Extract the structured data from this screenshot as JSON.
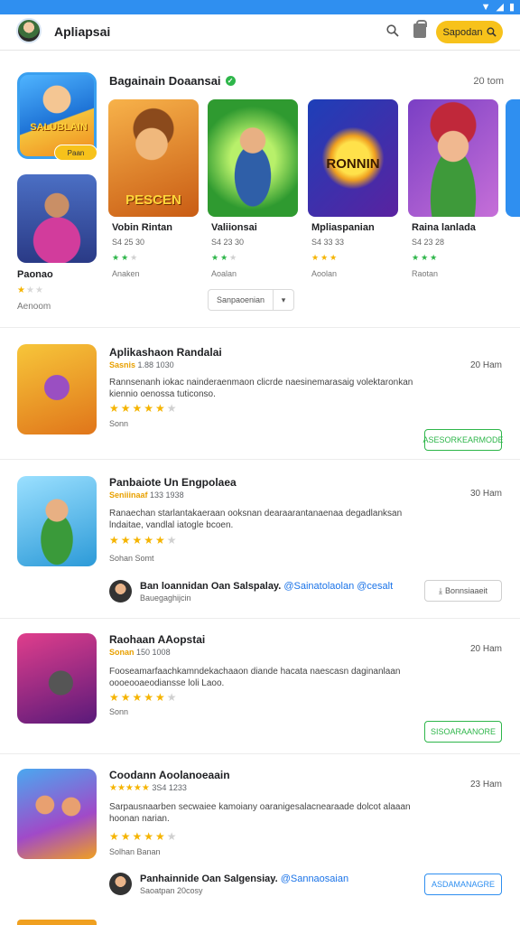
{
  "header": {
    "title": "Apliapsai",
    "button_label": "Sapodan"
  },
  "featured_section": {
    "title": "Bagainain Doaansai",
    "count": "20 tom",
    "feature": {
      "badge": "Paan",
      "art_word": "SALUBLAIN",
      "name": "Paonao",
      "rating": 1,
      "meta": "Aenoom"
    },
    "cards": [
      {
        "name": "Vobin Rintan",
        "size": "S4 25 30",
        "stars": 3,
        "label": "Anaken",
        "art_word": "PESCEN",
        "star_color": "#2eb64a"
      },
      {
        "name": "Valiionsai",
        "size": "S4 23 30",
        "stars": 3,
        "label": "Aoalan",
        "art_word": "",
        "star_color": "#2eb64a"
      },
      {
        "name": "Mpliaspanian",
        "size": "S4 33 33",
        "stars": 3,
        "label": "Aoolan",
        "art_word": "RONNIN",
        "star_color": "#f5b400"
      },
      {
        "name": "Raina lanlada",
        "size": "S4 23 28",
        "stars": 4,
        "label": "Raotan",
        "art_word": "",
        "star_color": "#2eb64a"
      }
    ],
    "pager_label": "Sanpaoenian"
  },
  "list": [
    {
      "title": "Aplikashaon Randalai",
      "sub_accent": "Sasnis",
      "sub_text": "1.88 1030",
      "date": "20 Ham",
      "description": "Rannsenanh iokac nainderaenmaon clicrde naesinemarasaig volektaronkan kiennio oenossa tuticonso.",
      "rating": 4,
      "meta": "Sonn",
      "action": "ASESORKEARMODE",
      "author": null
    },
    {
      "title": "Panbaiote Un Engpolaea",
      "sub_accent": "Seniiinaaf",
      "sub_text": "133 1938",
      "date": "30 Ham",
      "description": "Ranaechan starlantakaeraan ooksnan dearaarantanaenaa degadlanksan lndaitae, vandlal iatogle bcoen.",
      "rating": 4,
      "meta": "Sohan Somt",
      "action": "Bonnsiaaeit",
      "author": {
        "name": "Ban loannidan",
        "highlight": "Oan Salspalay.",
        "tags": "@Sainatolaolan @cesalt",
        "sub": "Bauegaghijcin"
      }
    },
    {
      "title": "Raohaan AAopstai",
      "sub_accent": "Sonan",
      "sub_text": "150 1008",
      "date": "20 Ham",
      "description": "Fooseamarfaachkamndekachaaon diande hacata naescasn daginanlaan oooeooaeodiansse loli Laoo.",
      "rating": 4,
      "meta": "Sonn",
      "action": "SISOARAANORE",
      "author": null
    },
    {
      "title": "Coodann Aoolanoeaain",
      "sub_accent": "",
      "sub_text": "3S4 1233",
      "date": "23 Ham",
      "description": "Sarpausnaarben secwaiee kamoiany oaranigesalacnearaade dolcot alaaan hoonan narian.",
      "rating": 4,
      "meta": "Solhan Banan",
      "action": "ASDAMANAGRE",
      "author": {
        "name": "Panhainnide",
        "highlight": "Oan Salgensiay.",
        "tags": "@Sannaosaian",
        "sub": "Saoatpan 20cosy"
      }
    }
  ]
}
